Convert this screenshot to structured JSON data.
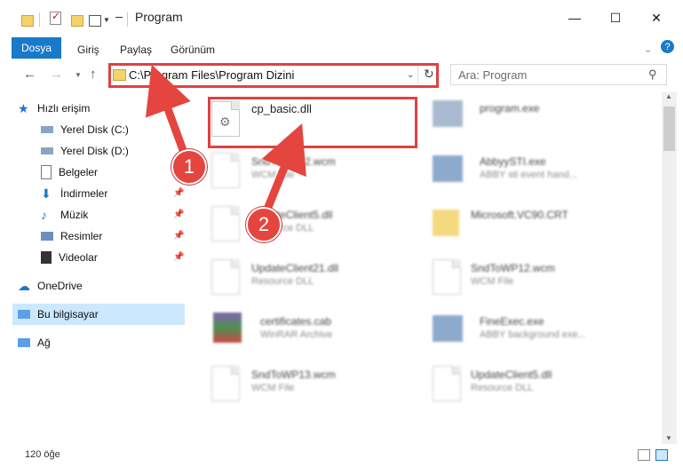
{
  "window": {
    "title": "Program",
    "minimize": "—",
    "maximize": "☐",
    "close": "✕"
  },
  "ribbon": {
    "tabs": [
      "Dosya",
      "Giriş",
      "Paylaş",
      "Görünüm"
    ],
    "help": "?"
  },
  "address": {
    "path": "C:\\Program Files\\Program Dizini",
    "search_placeholder": "Ara: Program"
  },
  "sidebar": {
    "items": [
      {
        "label": "Hızlı erişim",
        "icon": "star-icon"
      },
      {
        "label": "Yerel Disk (C:)",
        "icon": "drive-icon"
      },
      {
        "label": "Yerel Disk (D:)",
        "icon": "drive-icon"
      },
      {
        "label": "Belgeler",
        "icon": "documents-icon"
      },
      {
        "label": "İndirmeler",
        "icon": "download-icon"
      },
      {
        "label": "Müzik",
        "icon": "music-icon"
      },
      {
        "label": "Resimler",
        "icon": "pictures-icon"
      },
      {
        "label": "Videolar",
        "icon": "video-icon"
      },
      {
        "label": "OneDrive",
        "icon": "cloud-icon"
      },
      {
        "label": "Bu bilgisayar",
        "icon": "computer-icon"
      },
      {
        "label": "Ağ",
        "icon": "network-icon"
      }
    ]
  },
  "files": [
    {
      "name": "cp_basic.dll",
      "sub": ""
    },
    {
      "name": "program.exe",
      "sub": ""
    },
    {
      "name": "SndToWP12.wcm",
      "sub": "WCM File"
    },
    {
      "name": "AbbyySTI.exe",
      "sub": "ABBY sti event hand..."
    },
    {
      "name": "UpdateClient5.dll",
      "sub": "Resource DLL"
    },
    {
      "name": "Microsoft.VC90.CRT",
      "sub": ""
    },
    {
      "name": "UpdateClient21.dll",
      "sub": "Resource DLL"
    },
    {
      "name": "SndToWP12.wcm",
      "sub": "WCM File"
    },
    {
      "name": "certificates.cab",
      "sub": "WinRAR Archive"
    },
    {
      "name": "FineExec.exe",
      "sub": "ABBY background exe..."
    },
    {
      "name": "SndToWP13.wcm",
      "sub": "WCM File"
    },
    {
      "name": "UpdateClient5.dll",
      "sub": "Resource DLL"
    }
  ],
  "callouts": [
    "1",
    "2"
  ],
  "status": {
    "count": "120 öğe"
  },
  "colors": {
    "accent": "#1979ca",
    "highlight": "#e04040",
    "selected": "#cce8ff"
  }
}
